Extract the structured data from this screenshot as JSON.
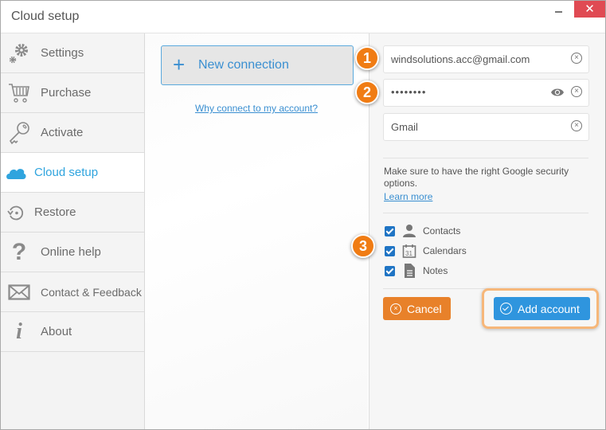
{
  "window": {
    "title": "Cloud setup",
    "close_glyph": "✕"
  },
  "sidebar": {
    "items": [
      {
        "label": "Settings",
        "icon": "gears-icon",
        "active": false
      },
      {
        "label": "Purchase",
        "icon": "cart-icon",
        "active": false
      },
      {
        "label": "Activate",
        "icon": "key-icon",
        "active": false
      },
      {
        "label": "Cloud setup",
        "icon": "cloud-icon",
        "active": true
      },
      {
        "label": "Restore",
        "icon": "restore-icon",
        "active": false
      },
      {
        "label": "Online help",
        "icon": "question-icon",
        "active": false
      },
      {
        "label": "Contact & Feedback",
        "icon": "envelope-icon",
        "active": false
      },
      {
        "label": "About",
        "icon": "info-icon",
        "active": false
      }
    ]
  },
  "main": {
    "new_connection_label": "New connection",
    "plus_glyph": "+",
    "why_link": "Why connect to my account?"
  },
  "form": {
    "email_value": "windsolutions.acc@gmail.com",
    "password_value": "••••••••",
    "provider_value": "Gmail",
    "clear_glyph": "×",
    "note": "Make sure to have the right Google security options.",
    "learn_more": "Learn more",
    "checkboxes": [
      {
        "label": "Contacts",
        "checked": true,
        "icon": "person-icon"
      },
      {
        "label": "Calendars",
        "checked": true,
        "icon": "calendar-icon"
      },
      {
        "label": "Notes",
        "checked": true,
        "icon": "note-icon"
      }
    ],
    "cancel_label": "Cancel",
    "add_label": "Add account"
  },
  "steps": [
    "1",
    "2",
    "3"
  ],
  "colors": {
    "accent_blue": "#2f95de",
    "cancel_orange": "#e8812a",
    "step_orange": "#f07c14",
    "close_red": "#e04a53",
    "active_item": "#2fa4de"
  }
}
